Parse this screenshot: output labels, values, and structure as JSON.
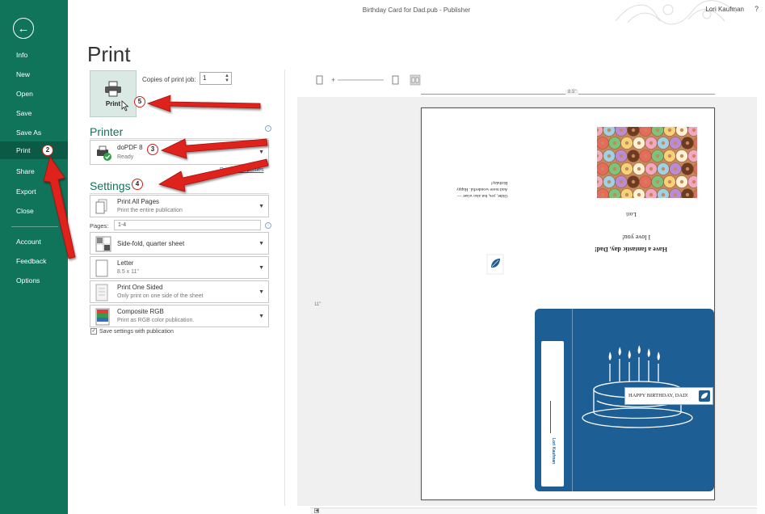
{
  "window": {
    "doc_title": "Birthday Card for Dad.pub - Publisher",
    "user_name": "Lori Kaufman",
    "help_label": "?"
  },
  "sidebar": {
    "back_icon": "back-arrow-icon",
    "items": [
      {
        "label": "Info"
      },
      {
        "label": "New"
      },
      {
        "label": "Open"
      },
      {
        "label": "Save"
      },
      {
        "label": "Save As"
      },
      {
        "label": "Print",
        "active": true,
        "badge": "2"
      },
      {
        "label": "Share"
      },
      {
        "label": "Export"
      },
      {
        "label": "Close"
      },
      {
        "label": "Account"
      },
      {
        "label": "Feedback"
      },
      {
        "label": "Options"
      }
    ]
  },
  "print_pane": {
    "heading": "Print",
    "print_button_label": "Print",
    "print_badge": "5",
    "copies_label": "Copies of print job:",
    "copies_value": "1",
    "printer_heading": "Printer",
    "printer_name": "doPDF 8",
    "printer_status": "Ready",
    "printer_badge": "3",
    "printer_properties": "Printer Properties",
    "settings_heading": "Settings",
    "settings_badge": "4",
    "pages_what_main": "Print All Pages",
    "pages_what_sub": "Print the entire publication",
    "pages_label": "Pages:",
    "pages_value": "1-4",
    "layout_main": "Side-fold, quarter sheet",
    "paper_main": "Letter",
    "paper_sub": "8.5 x 11\"",
    "sides_main": "Print One Sided",
    "sides_sub": "Only print on one side of the sheet",
    "color_main": "Composite RGB",
    "color_sub": "Print as RGB color publication.",
    "save_settings": "Save settings with publication"
  },
  "preview": {
    "ruler_width": "8.5\"",
    "ruler_height": "11\"",
    "card_line1": "Have a fantastic day, Dad!",
    "card_line2": "I love you!",
    "card_signature": "Lori",
    "card_small1": "Older, yes, but also wiser —",
    "card_small2": "And more wonderful. Happy",
    "card_small3": "Birthday!",
    "cover_label": "HAPPY BIRTHDAY, DAD!",
    "spine_text": "Lori Kaufman"
  },
  "colors": {
    "sidebar": "#10745b",
    "accent": "#10745b",
    "cover_blue": "#1d5f94",
    "arrow_red": "#e0201a"
  }
}
